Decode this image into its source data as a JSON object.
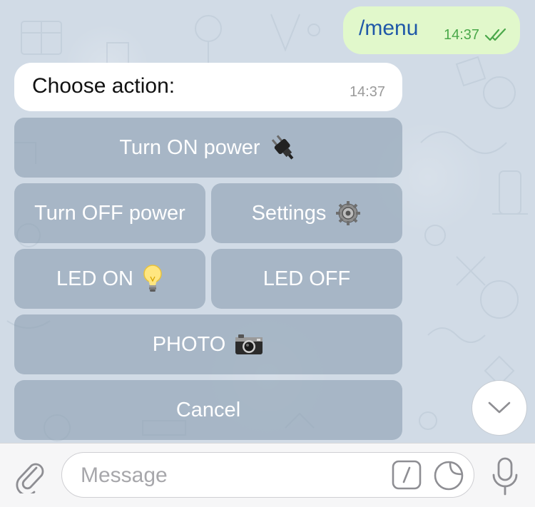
{
  "outgoing_message": {
    "text": "/menu",
    "time": "14:37",
    "status": "read"
  },
  "incoming_message": {
    "text": "Choose action:",
    "time": "14:37"
  },
  "keyboard": {
    "row1": [
      {
        "label": "Turn ON power",
        "icon": "electric-plug-icon"
      }
    ],
    "row2": [
      {
        "label": "Turn OFF power"
      },
      {
        "label": "Settings",
        "icon": "gear-icon"
      }
    ],
    "row3": [
      {
        "label": "LED ON",
        "icon": "light-bulb-icon"
      },
      {
        "label": "LED OFF"
      }
    ],
    "row4": [
      {
        "label": "PHOTO",
        "icon": "camera-icon"
      }
    ],
    "row5": [
      {
        "label": "Cancel"
      }
    ]
  },
  "input": {
    "placeholder": "Message",
    "value": ""
  },
  "colors": {
    "outgoing_bubble": "#e1f8cb",
    "outgoing_text": "#1f58a8",
    "outgoing_time": "#4aa84a",
    "keyboard_button": "#8ca0b2",
    "chat_background": "#d1dbe6"
  }
}
